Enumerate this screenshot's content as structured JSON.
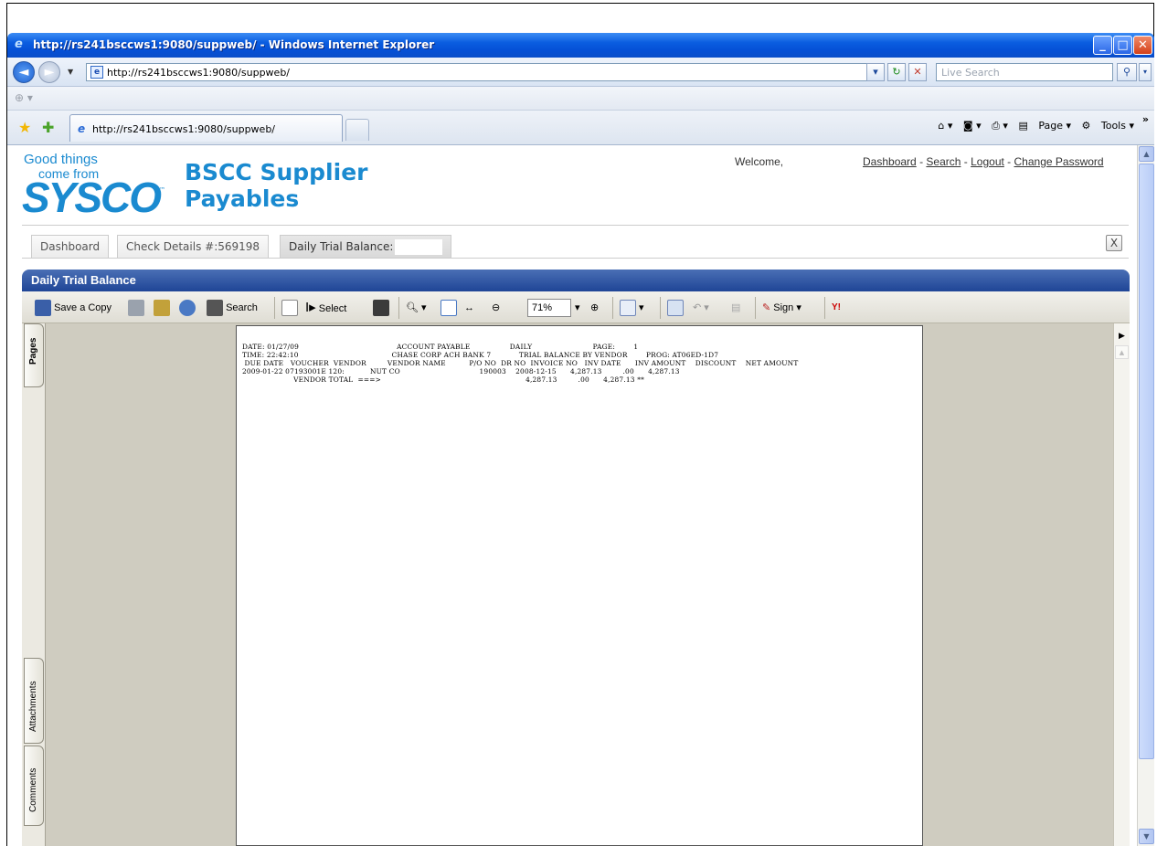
{
  "browser": {
    "title": "http://rs241bsccws1:9080/suppweb/ - Windows Internet Explorer",
    "address": "http://rs241bsccws1:9080/suppweb/",
    "search_placeholder": "Live Search",
    "tab_title": "http://rs241bsccws1:9080/suppweb/",
    "page_label": "Page",
    "tools_label": "Tools"
  },
  "header": {
    "logo_line1": "Good things",
    "logo_line2": "come from",
    "logo_brand": "SYSCO",
    "app_title_line1": "BSCC Supplier",
    "app_title_line2": "Payables",
    "welcome": "Welcome,",
    "links": {
      "dashboard": "Dashboard",
      "search": "Search",
      "logout": "Logout",
      "change_password": "Change Password"
    },
    "link_separator": "-"
  },
  "tabs": [
    {
      "label": "Dashboard"
    },
    {
      "label": "Check Details #:569198"
    },
    {
      "label": "Daily Trial Balance:"
    }
  ],
  "close_tab_label": "X",
  "panel": {
    "title": "Daily Trial Balance"
  },
  "acrobat": {
    "save_copy": "Save a Copy",
    "search": "Search",
    "select": "Select",
    "zoom": "71%",
    "sign": "Sign",
    "side_tabs": {
      "pages": "Pages",
      "attachments": "Attachments",
      "comments": "Comments"
    }
  },
  "report": {
    "lines": [
      "DATE: 01/27/09                                          ACCOUNT PAYABLE                 DAILY                          PAGE:        1",
      "TIME: 22:42:10                                        CHASE CORP ACH BANK 7            TRIAL BALANCE BY VENDOR        PROG: AT06ED-1D7",
      " DUE DATE   VOUCHER  VENDOR         VENDOR NAME          P/O NO  DR NO  INVOICE NO   INV DATE      INV AMOUNT    DISCOUNT    NET AMOUNT",
      "2009-01-22 07193001E 120:           NUT CO                                  190003    2008-12-15      4,287.13         .00      4,287.13",
      "                      VENDOR TOTAL  ===>                                                              4,287.13         .00      4,287.13 **"
    ]
  }
}
